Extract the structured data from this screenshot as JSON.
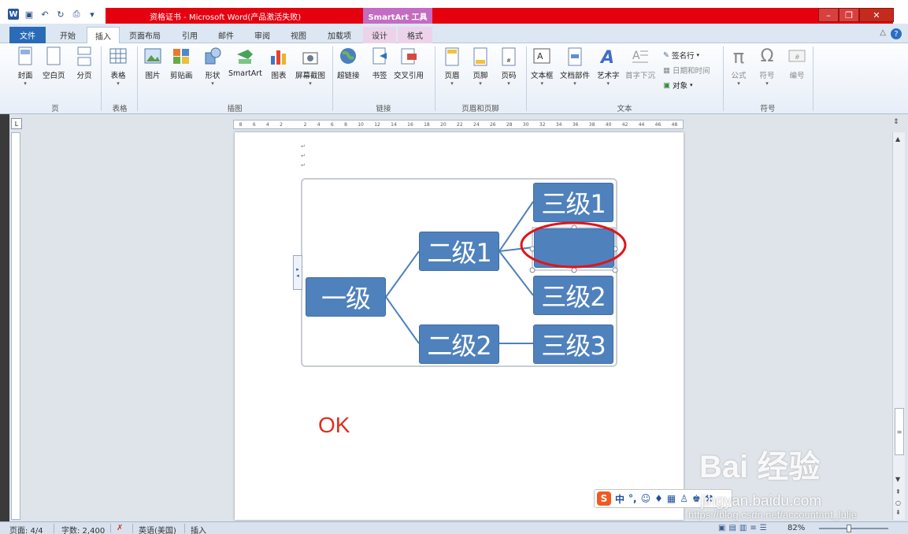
{
  "window": {
    "title": "资格证书 - Microsoft Word(产品激活失败)",
    "contextual_tab_group": "SmartArt 工具",
    "accent_red": "#e50010",
    "contextual_color": "#c36cc1"
  },
  "quick_access": [
    "word-logo",
    "save-icon",
    "undo-icon",
    "redo-icon",
    "print-icon",
    "customize-icon"
  ],
  "tabs": [
    {
      "label": "文件"
    },
    {
      "label": "开始"
    },
    {
      "label": "插入"
    },
    {
      "label": "页面布局"
    },
    {
      "label": "引用"
    },
    {
      "label": "邮件"
    },
    {
      "label": "审阅"
    },
    {
      "label": "视图"
    },
    {
      "label": "加载项"
    },
    {
      "label": "设计"
    },
    {
      "label": "格式"
    }
  ],
  "active_tab": "插入",
  "ribbon": {
    "pages": {
      "group": "页",
      "cover": "封面",
      "blank": "空白页",
      "break": "分页"
    },
    "tables": {
      "group": "表格",
      "table": "表格"
    },
    "illustrations": {
      "group": "插图",
      "picture": "图片",
      "clipart": "剪贴画",
      "shapes": "形状",
      "smartart": "SmartArt",
      "chart": "图表",
      "screenshot": "屏幕截图"
    },
    "links": {
      "group": "链接",
      "hyperlink": "超链接",
      "bookmark": "书签",
      "crossref": "交叉引用"
    },
    "headerfooter": {
      "group": "页眉和页脚",
      "header": "页眉",
      "footer": "页脚",
      "pagenum": "页码"
    },
    "text": {
      "group": "文本",
      "textbox": "文本框",
      "quickparts": "文档部件",
      "wordart": "艺术字",
      "dropcap": "首字下沉",
      "signature": "签名行",
      "datetime": "日期和时间",
      "object": "对象"
    },
    "symbols": {
      "group": "符号",
      "equation": "公式",
      "symbol": "符号",
      "number": "编号"
    }
  },
  "ruler": {
    "ticks": [
      "8",
      "6",
      "4",
      "2",
      "",
      "2",
      "4",
      "6",
      "8",
      "10",
      "12",
      "14",
      "16",
      "18",
      "20",
      "22",
      "24",
      "26",
      "28",
      "30",
      "32",
      "34",
      "36",
      "38",
      "40",
      "42",
      "44",
      "46",
      "48"
    ]
  },
  "smartart": {
    "level1": "一级",
    "level2": [
      "二级1",
      "二级2"
    ],
    "level3": [
      "三级1",
      "",
      "三级2",
      "三级3"
    ],
    "node_color": "#4f81bd",
    "highlight_color": "#e0151a"
  },
  "document": {
    "ok_text": "OK"
  },
  "ime": {
    "lang": "中",
    "icons": [
      "sogou-s-icon",
      "punctuation-icon",
      "emoji-icon",
      "mic-icon",
      "keyboard-icon",
      "user-icon",
      "shirt-icon",
      "wrench-icon"
    ]
  },
  "status": {
    "page": "页面: 4/4",
    "words": "字数: 2,400",
    "language": "英语(美国)",
    "mode": "插入",
    "zoom": "82%"
  },
  "watermarks": {
    "baidu": "Bai 经验",
    "jingyan": "jingyan.baidu.com",
    "csdn": "https://blog.csdn.net/accountant_lulie"
  }
}
